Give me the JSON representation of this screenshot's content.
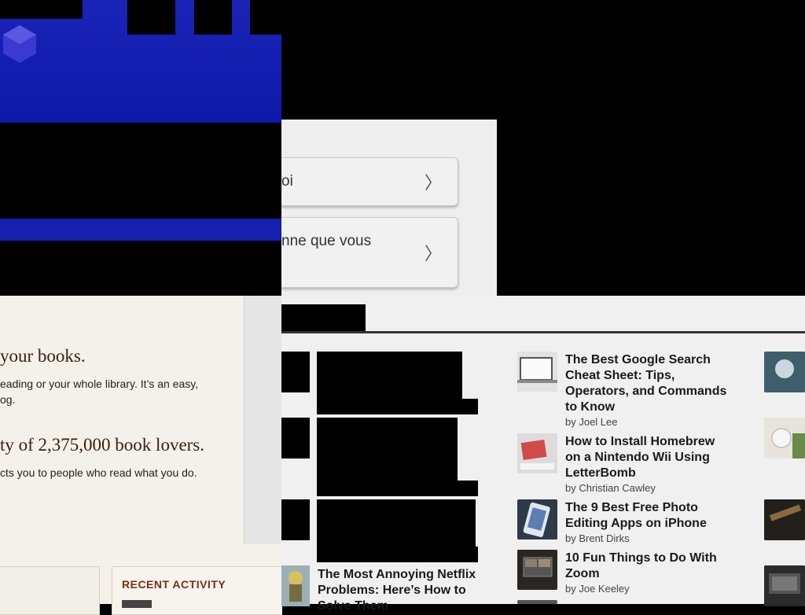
{
  "choices": [
    {
      "text": "oi",
      "chevron": "chevron-right-icon"
    },
    {
      "text": "nne que vous",
      "chevron": "chevron-right-icon"
    }
  ],
  "goodreads": {
    "heading1": "your books.",
    "sub1_line1": "eading or your whole library. It’s an easy,",
    "sub1_line2": "og.",
    "heading2": "ty of 2,375,000 book lovers.",
    "sub2": "cts you to people who read what you do.",
    "recent_activity": "RECENT ACTIVITY"
  },
  "articles": [
    {
      "title": "The Best Google Search Cheat Sheet: Tips, Operators, and Commands to Know",
      "by": "by Joel Lee",
      "thumb": "laptop-google-thumbnail"
    },
    {
      "title": "How to Install Homebrew on a Nintendo Wii Using LetterBomb",
      "by": "by Christian Cawley",
      "thumb": "wii-letter-thumbnail"
    },
    {
      "title": "The 9 Best Free Photo Editing Apps on iPhone",
      "by": "by Brent Dirks",
      "thumb": "iphone-photo-thumbnail"
    },
    {
      "title": "10 Fun Things to Do With Zoom",
      "by": "by Joe Keeley",
      "thumb": "zoom-laptop-thumbnail"
    }
  ],
  "netflix_article": {
    "title": "The Most Annoying Netflix Problems: Here’s How to Solve Them"
  },
  "colors": {
    "banner_blue": "#1a24b8",
    "goodreads_brown": "#382110",
    "recent_red": "#7a2c1a"
  }
}
